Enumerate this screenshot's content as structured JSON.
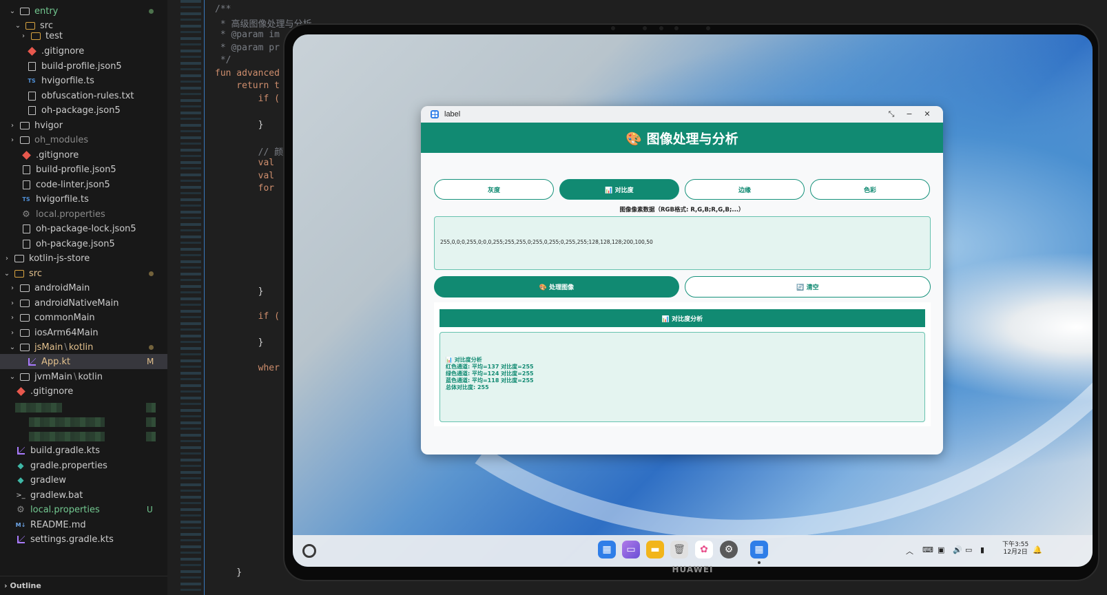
{
  "explorer": {
    "rows": [
      {
        "label": "entry"
      },
      {
        "label": "src"
      },
      {
        "label": "test"
      },
      {
        "label": ".gitignore"
      },
      {
        "label": "build-profile.json5"
      },
      {
        "label": "hvigorfile.ts"
      },
      {
        "label": "obfuscation-rules.txt"
      },
      {
        "label": "oh-package.json5"
      },
      {
        "label": "hvigor"
      },
      {
        "label": "oh_modules"
      },
      {
        "label": ".gitignore"
      },
      {
        "label": "build-profile.json5"
      },
      {
        "label": "code-linter.json5"
      },
      {
        "label": "hvigorfile.ts"
      },
      {
        "label": "local.properties"
      },
      {
        "label": "oh-package-lock.json5"
      },
      {
        "label": "oh-package.json5"
      },
      {
        "label": "kotlin-js-store"
      },
      {
        "label": "src"
      },
      {
        "label": "androidMain"
      },
      {
        "label": "androidNativeMain"
      },
      {
        "label": "commonMain"
      },
      {
        "label": "iosArm64Main"
      },
      {
        "label": "jsMain",
        "sub": "kotlin"
      },
      {
        "label": "App.kt",
        "badge": "M"
      },
      {
        "label": "jvmMain",
        "sub": "kotlin"
      },
      {
        "label": ".gitignore"
      },
      {
        "label": "build.gradle.kts"
      },
      {
        "label": "gradle.properties"
      },
      {
        "label": "gradlew"
      },
      {
        "label": "gradlew.bat"
      },
      {
        "label": "local.properties",
        "badge": "U"
      },
      {
        "label": "README.md"
      },
      {
        "label": "settings.gradle.kts"
      }
    ],
    "path_separator": "\\",
    "outline_label": "Outline"
  },
  "editor": {
    "lines": [
      "/**",
      " * 高级图像处理与分析",
      " * @param im",
      " * @param pr",
      " */",
      "fun advanced",
      "    return t",
      "        if (",
      "        }",
      "        // 颜",
      "        val",
      "        val",
      "        for",
      "        }",
      "        if (",
      "        }",
      "        wher",
      "    }"
    ]
  },
  "tablet": {
    "brand": "HUAWEI",
    "window": {
      "title": "label",
      "header": "🎨 图像处理与分析",
      "tabs": [
        "灰度",
        "📊 对比度",
        "边缘",
        "色彩"
      ],
      "active_tab_index": 1,
      "pixel_label": "图像像素数据（RGB格式: R,G,B;R,G,B;...）",
      "pixel_value": "255,0,0;0,255,0;0,0,255;255,255,0;255,0,255;0,255,255;128,128,128;200,100,50",
      "process_label": "🎨 处理图像",
      "clear_label": "🔄 清空",
      "result_title": "📊 对比度分析",
      "result_lines": [
        "📊 对比度分析",
        "红色通道: 平均=137 对比度=255",
        "绿色通道: 平均=124 对比度=255",
        "蓝色通道: 平均=118 对比度=255",
        "总体对比度: 255"
      ],
      "controls": {
        "restore": "⤡",
        "minimize": "−",
        "close": "✕"
      }
    },
    "taskbar": {
      "clock_line1": "下午3:55",
      "clock_line2": "12月2日",
      "tray_icons": [
        "chevron-up-icon",
        "keyboard-icon",
        "ime-icon",
        "volume-icon",
        "display-icon",
        "battery-icon",
        "bell-icon"
      ],
      "dock_icons": [
        "launcher-icon",
        "gallery-icon",
        "files-icon",
        "trash-icon",
        "photos-icon",
        "settings-icon",
        "app-icon"
      ]
    }
  },
  "colors": {
    "accent": "#118a72",
    "accent_light_bg": "#e4f4f0",
    "ide_bg": "#1f1f1f",
    "git_modified": "#e2c08d",
    "git_untracked": "#73c991"
  }
}
